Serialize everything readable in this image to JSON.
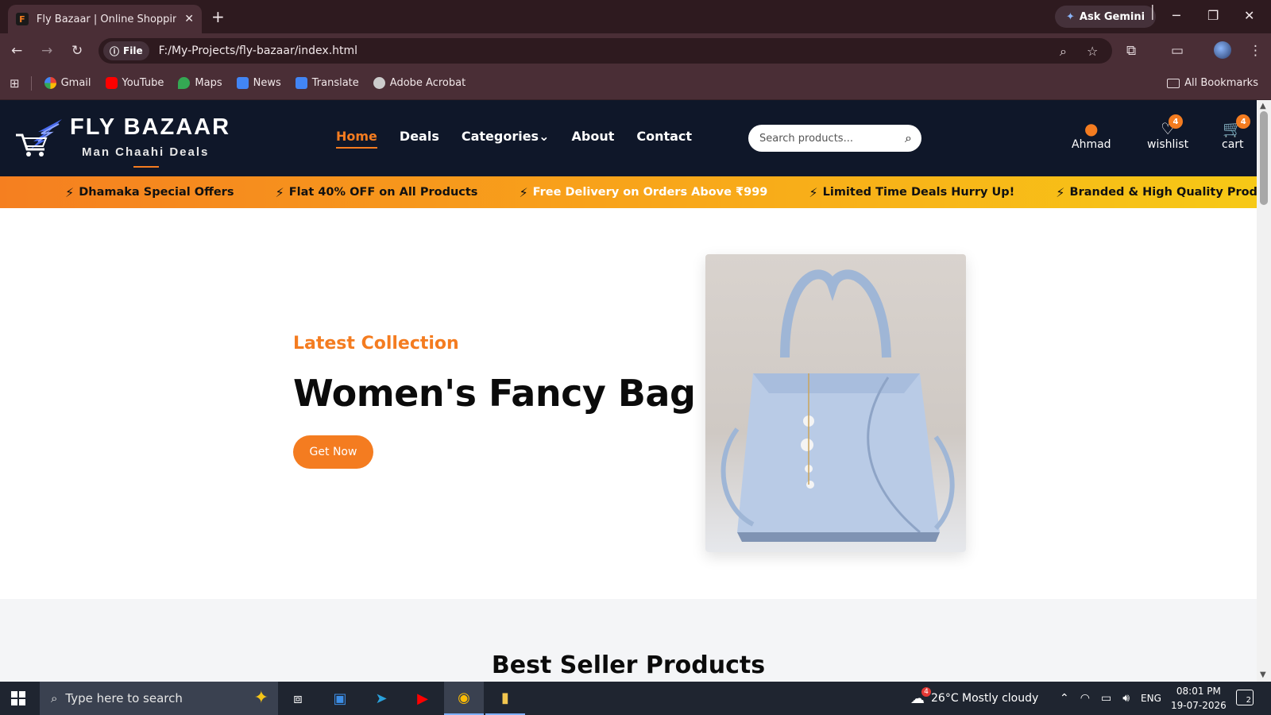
{
  "browser": {
    "tab_title": "Fly Bazaar | Online Shopping fo",
    "tab_favicon_letter": "F",
    "new_tab_symbol": "+",
    "gemini_label": "Ask Gemini",
    "file_chip": "File",
    "url": "F:/My-Projects/fly-bazaar/index.html",
    "bookmarks": [
      {
        "label": "Gmail",
        "color": "#ea4335"
      },
      {
        "label": "YouTube",
        "color": "#ff0000"
      },
      {
        "label": "Maps",
        "color": "#34a853"
      },
      {
        "label": "News",
        "color": "#4285f4"
      },
      {
        "label": "Translate",
        "color": "#4285f4"
      },
      {
        "label": "Adobe Acrobat",
        "color": "#cccccc"
      }
    ],
    "all_bookmarks": "All Bookmarks"
  },
  "site": {
    "brand": "FLY BAZAAR",
    "tagline": "Man Chaahi Deals",
    "nav": [
      {
        "label": "Home",
        "active": true
      },
      {
        "label": "Deals",
        "active": false
      },
      {
        "label": "Categories",
        "active": false
      },
      {
        "label": "About",
        "active": false
      },
      {
        "label": "Contact",
        "active": false
      }
    ],
    "categories_caret": "⌄",
    "search_placeholder": "Search products...",
    "user_label": "Ahmad",
    "wishlist_label": "wishlist",
    "wishlist_count": "4",
    "cart_label": "cart",
    "cart_count": "4",
    "accent_color": "#f47c20",
    "header_bg": "#0f1729"
  },
  "ticker": [
    "Dhamaka Special Offers",
    "Flat 40% OFF on All Products",
    "Free Delivery on Orders Above ₹999",
    "Limited Time Deals Hurry Up!",
    "Branded & High Quality Products"
  ],
  "hero": {
    "eyebrow": "Latest Collection",
    "title": "Women's Fancy Bag",
    "button": "Get Now"
  },
  "best_seller_title": "Best Seller Products",
  "taskbar": {
    "search_placeholder": "Type here to search",
    "weather": "26°C  Mostly cloudy",
    "weather_badge": "4",
    "language": "ENG",
    "time": "08:01 PM",
    "date": "19-07-2026",
    "notification_count": "2"
  }
}
